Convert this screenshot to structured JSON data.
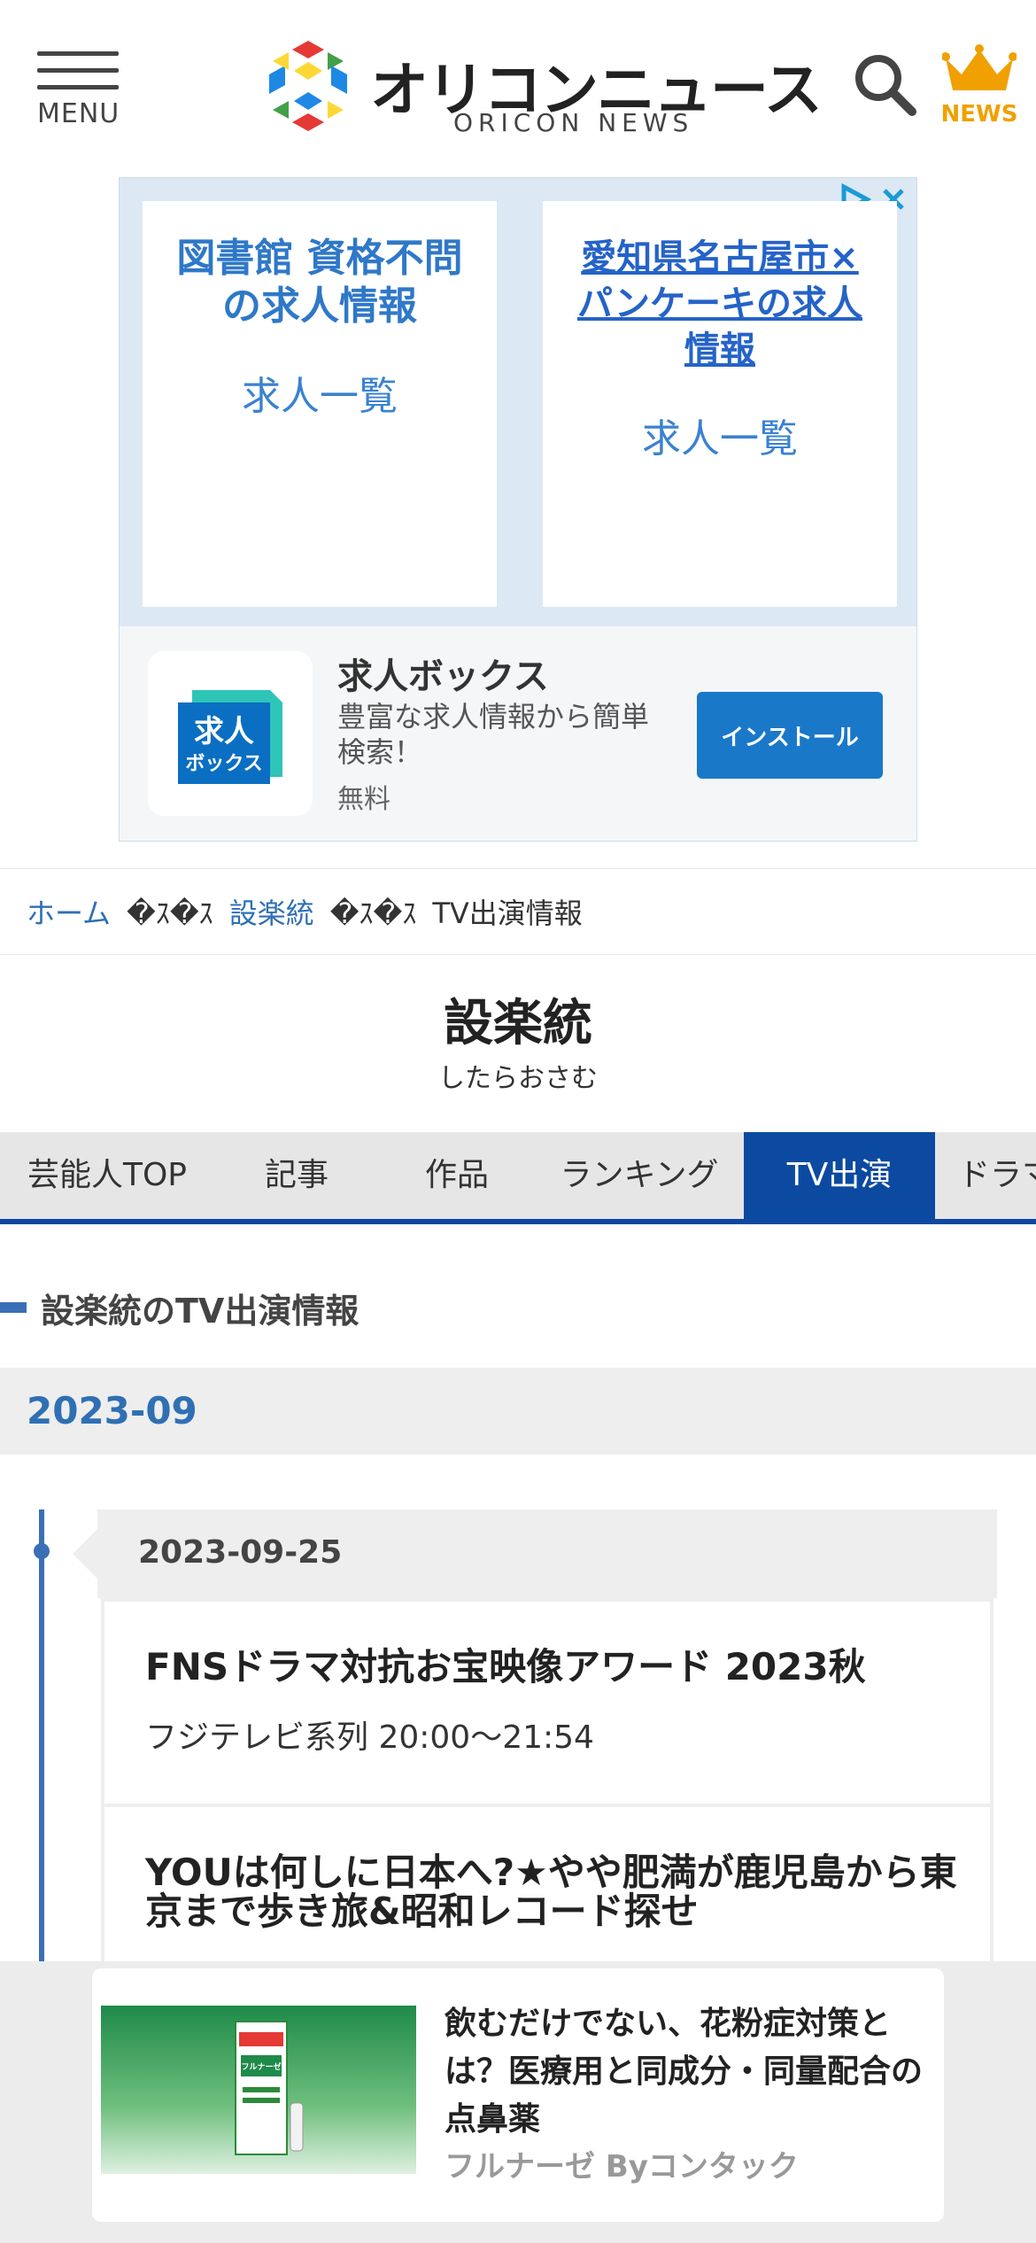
{
  "header": {
    "menu_label": "MENU",
    "logo_text": "オリコンニュース",
    "logo_subtext": "ORICON NEWS",
    "news_label": "NEWS",
    "colors": {
      "news_accent": "#f0a000"
    }
  },
  "ad": {
    "cards": [
      {
        "title": "図書館 資格不問の求人情報",
        "link": "求人一覧"
      },
      {
        "title": "愛知県名古屋市×パンケーキの求人情報",
        "link": "求人一覧"
      }
    ],
    "app": {
      "icon_text_line1": "求人",
      "icon_text_line2": "ボックス",
      "name": "求人ボックス",
      "description": "豊富な求人情報から簡単検索！",
      "price": "無料",
      "install_label": "インストール"
    }
  },
  "breadcrumb": {
    "home": "ホーム",
    "sep1": "�ｽ�ｽ",
    "person": "設楽統",
    "sep2": "�ｽ�ｽ",
    "current": "TV出演情報"
  },
  "person": {
    "name": "設楽統",
    "reading": "したらおさむ"
  },
  "tabs": [
    {
      "label": "芸能人TOP",
      "active": false
    },
    {
      "label": "記事",
      "active": false
    },
    {
      "label": "作品",
      "active": false
    },
    {
      "label": "ランキング",
      "active": false
    },
    {
      "label": "TV出演",
      "active": true
    },
    {
      "label": "ドラマ",
      "active": false
    }
  ],
  "section": {
    "title": "設楽統のTV出演情報"
  },
  "month": "2023-09",
  "schedule": {
    "date": "2023-09-25",
    "programs": [
      {
        "title": "FNSドラマ対抗お宝映像アワード 2023秋",
        "info": "フジテレビ系列 20:00〜21:54"
      },
      {
        "title": "YOUは何しに日本へ?★やや肥満が鹿児島から東京まで歩き旅&昭和レコード探せ",
        "info": ""
      }
    ]
  },
  "bottom_ad": {
    "product_label": "フルナーゼ",
    "title": "飲むだけでない、花粉症対策とは？医療用と同成分・同量配合の点鼻薬",
    "sponsor": "フルナーゼ Byコンタック"
  }
}
